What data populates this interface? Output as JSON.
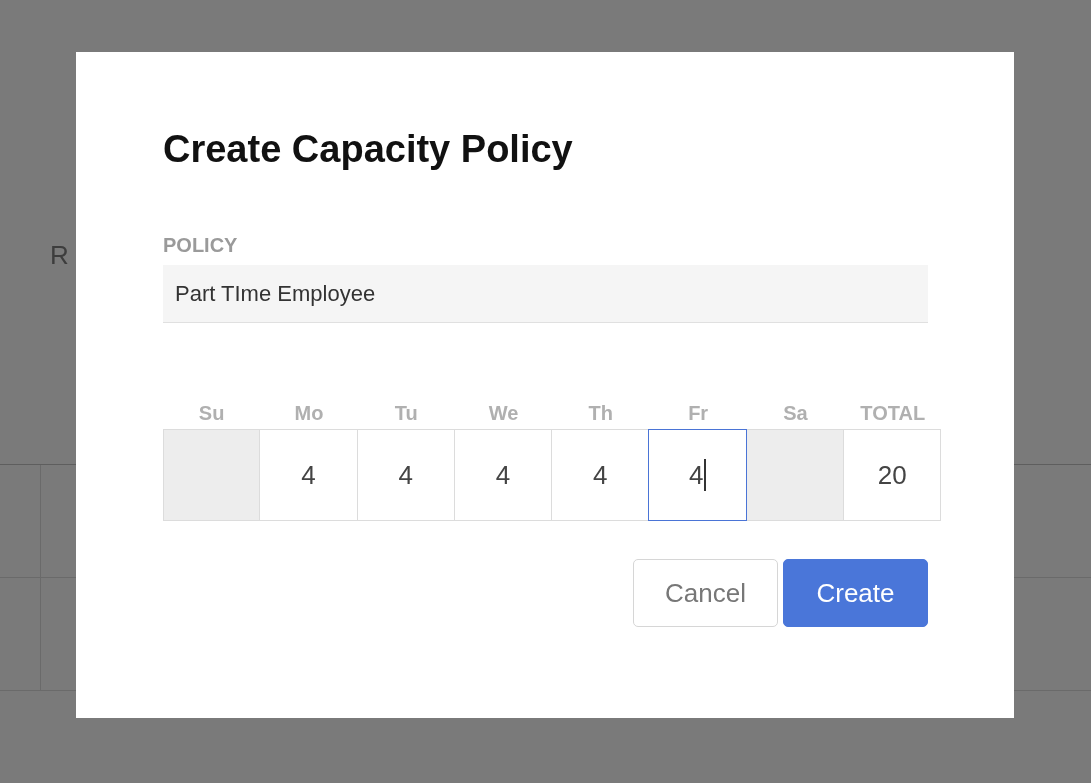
{
  "background": {
    "tabs": [
      "R"
    ]
  },
  "dialog": {
    "title": "Create Capacity Policy",
    "policy": {
      "label": "POLICY",
      "value": "Part TIme Employee"
    },
    "days": [
      {
        "label": "Su",
        "disabled": true,
        "focused": false
      },
      {
        "label": "Mo",
        "value": "4",
        "disabled": false,
        "focused": false
      },
      {
        "label": "Tu",
        "value": "4",
        "disabled": false,
        "focused": false
      },
      {
        "label": "We",
        "value": "4",
        "disabled": false,
        "focused": false
      },
      {
        "label": "Th",
        "value": "4",
        "disabled": false,
        "focused": false
      },
      {
        "label": "Fr",
        "value": "4",
        "disabled": false,
        "focused": true
      },
      {
        "label": "Sa",
        "disabled": true,
        "focused": false
      }
    ],
    "total": {
      "label": "TOTAL",
      "value": "20"
    },
    "buttons": [
      {
        "label": "Cancel",
        "kind": "secondary"
      },
      {
        "label": "Create",
        "kind": "primary"
      }
    ]
  }
}
